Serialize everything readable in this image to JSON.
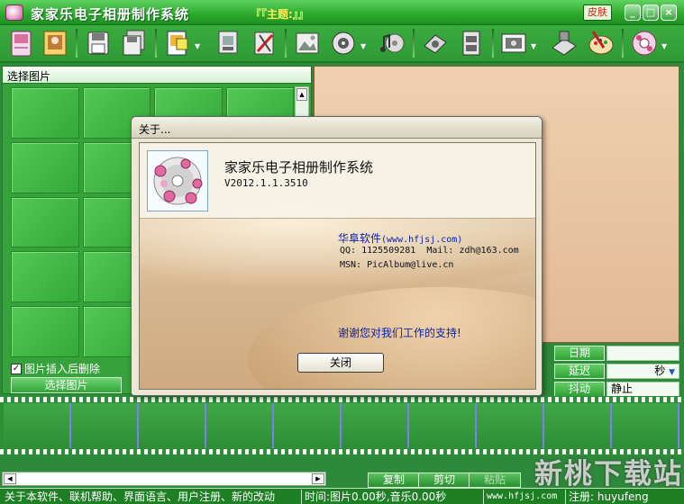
{
  "window": {
    "title": "家家乐电子相册制作系统",
    "theme": "『『主题:』』",
    "skin_label": "皮肤",
    "minimize": "_",
    "maximize": "□",
    "close": "×"
  },
  "toolbar": {
    "icons": [
      "album-icon",
      "photo-icon",
      "save-icon",
      "save-all-icon",
      "document-icon",
      "print-icon",
      "tools-icon",
      "landscape-icon",
      "settings-icon",
      "music-icon",
      "burn-icon",
      "film-icon",
      "screen-icon",
      "network-icon",
      "paint-icon",
      "disc-icon"
    ]
  },
  "left_panel": {
    "header": "选择图片",
    "checkbox_label": "图片插入后删除",
    "checkbox_mark": "✓",
    "select_button": "选择图片",
    "scroll_up": "▲"
  },
  "fields": {
    "date_label": "日期",
    "date_value": "",
    "delay_label": "延迟",
    "delay_unit": "秒",
    "delay_arrow": "▼",
    "jitter_label": "抖动",
    "jitter_value": "静止"
  },
  "bottom": {
    "copy": "复制",
    "cut": "剪切",
    "paste": "粘贴",
    "left_arrow": "◀",
    "right_arrow": "▶"
  },
  "watermark": "新桃下载站",
  "status": {
    "menu_links": "关于本软件、联机帮助、界面语言、用户注册、新的改动",
    "time_info": "时间:图片0.00秒,音乐0.00秒",
    "site": "www.hfjsj.com",
    "register": "注册: huyufeng"
  },
  "dialog": {
    "title": "关于...",
    "product_name": "家家乐电子相册制作系统",
    "version": "V2012.1.1.3510",
    "company_name": "华阜软件",
    "company_url": "(www.hfjsj.com)",
    "qq_line": "QQ: 1125509281  Mail: zdh@163.com",
    "msn_line": "MSN: PicAlbum@live.cn",
    "thanks": "谢谢您对我们工作的支持!",
    "close_button": "关闭"
  },
  "colors": {
    "app_green": "#2d8a3a",
    "title_green": "#2aa82a",
    "dialog_link_blue": "#0a1fa8",
    "preview_tan": "#ebc9a6"
  }
}
